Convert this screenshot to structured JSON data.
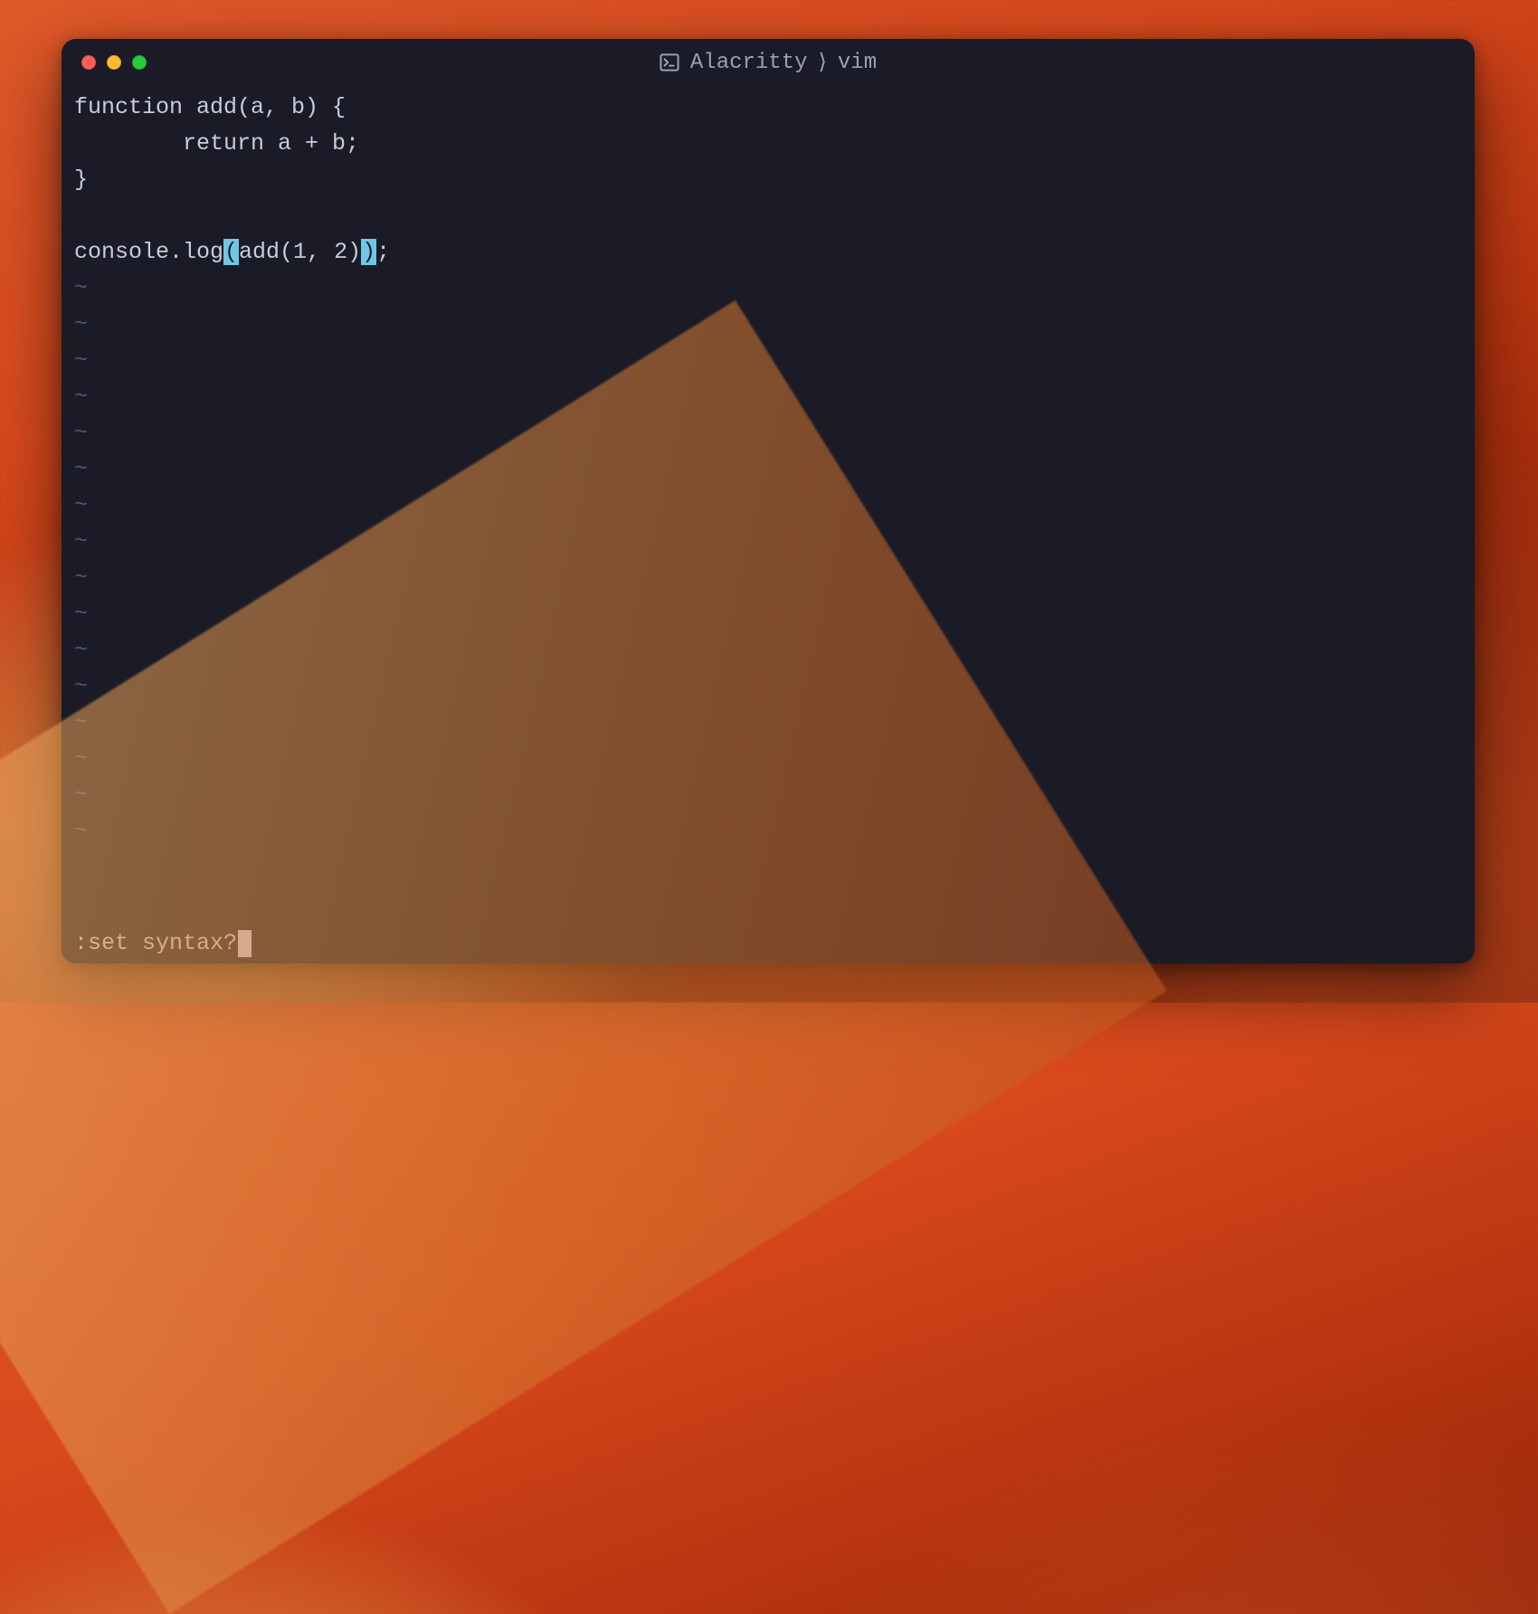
{
  "window": {
    "title_app": "Alacritty",
    "title_sep": "⟩",
    "title_proc": "vim"
  },
  "code": {
    "l1": "function add(a, b) {",
    "l2": "        return a + b;",
    "l3": "}",
    "l5_a": "console.log",
    "l5_p1": "(",
    "l5_b": "add(1, 2)",
    "l5_p2": ")",
    "l5_c": ";"
  },
  "tilde_char": "~",
  "tilde_count": 16,
  "command": {
    "text": ":set syntax?"
  },
  "colors": {
    "bg": "#1a1b26",
    "text": "#c8ccdc",
    "tilde": "#4f5572",
    "hl_bg": "#6fc7e5",
    "traffic_red": "#ff5f57",
    "traffic_yellow": "#febc2e",
    "traffic_green": "#28c840",
    "title": "#9aa0b4"
  }
}
